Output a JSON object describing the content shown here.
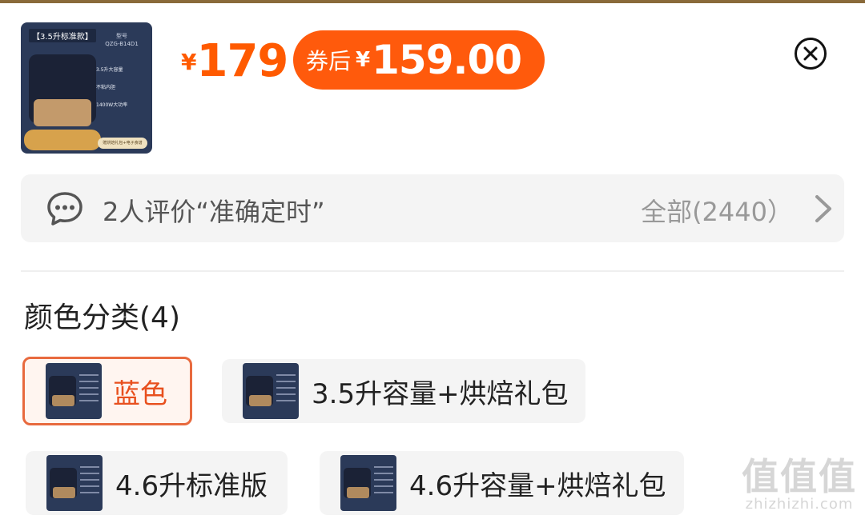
{
  "product": {
    "thumbnail": {
      "tag": "【3.5升标准款】",
      "model_label": "型号",
      "model": "QZG-B14D1",
      "features": [
        "3.5升大容量",
        "不粘内胆",
        "1400W大功率"
      ],
      "badge": "赠烘焙礼包+电子食谱"
    },
    "price_symbol": "¥",
    "price": "179",
    "coupon": {
      "label": "券后",
      "symbol": "¥",
      "price": "159.00"
    }
  },
  "close_icon": "close-circle-icon",
  "review": {
    "text": "2人评价“准确定时”",
    "all_label": "全部(2440）",
    "icon": "chat-bubble-icon"
  },
  "variants": {
    "title": "颜色分类(4)",
    "options": [
      {
        "label": "蓝色",
        "selected": true
      },
      {
        "label": "3.5升容量+烘焙礼包",
        "selected": false
      },
      {
        "label": "4.6升标准版",
        "selected": false
      },
      {
        "label": "4.6升容量+烘焙礼包",
        "selected": false
      }
    ]
  },
  "watermark": {
    "logo": "值值值",
    "site": "zhizhizhi.com"
  },
  "colors": {
    "accent": "#ff5a00",
    "coupon_bg": "#ff5a0c",
    "selected_border": "#e86a3e"
  }
}
